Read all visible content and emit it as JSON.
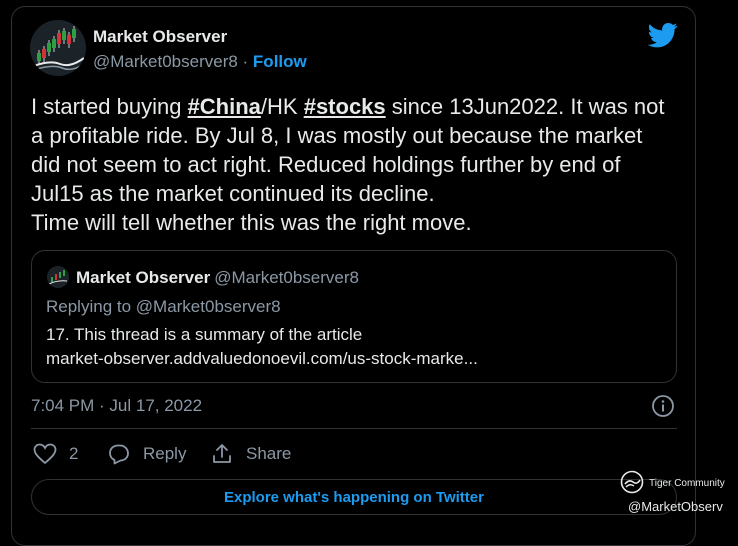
{
  "tweet": {
    "author_name": "Market Observer",
    "handle": "@Market0bserver8",
    "separator": " · ",
    "follow_label": "Follow",
    "body": {
      "t1": "I started buying ",
      "tag1": "#China",
      "t2": "/HK ",
      "tag2": "#stocks",
      "t3": " since 13Jun2022. It was not a profitable ride. By Jul 8, I was mostly out because the market did not seem to act right. Reduced holdings further by end of Jul15 as the market continued its decline.",
      "t4": "Time will tell whether this was the right move."
    },
    "quoted": {
      "author_name": "Market Observer",
      "handle": "@Market0bserver8",
      "replying_to": "Replying to @Market0bserver8",
      "line1": "17. This thread is a summary of the article",
      "line2": "market-observer.addvaluedonoevil.com/us-stock-marke..."
    },
    "timestamp": "7:04 PM · Jul 17, 2022",
    "like_count": "2",
    "reply_label": "Reply",
    "share_label": "Share",
    "explore_label": "Explore what's happening on Twitter"
  },
  "watermark": {
    "name": "Tiger Community",
    "handle": "@MarketObserv"
  },
  "colors": {
    "accent": "#1d9bf0",
    "background": "#000000",
    "muted": "#8b98a5"
  },
  "icons": [
    "twitter-bird-icon",
    "info-icon",
    "heart-icon",
    "reply-icon",
    "share-icon",
    "tiger-logo-icon"
  ]
}
